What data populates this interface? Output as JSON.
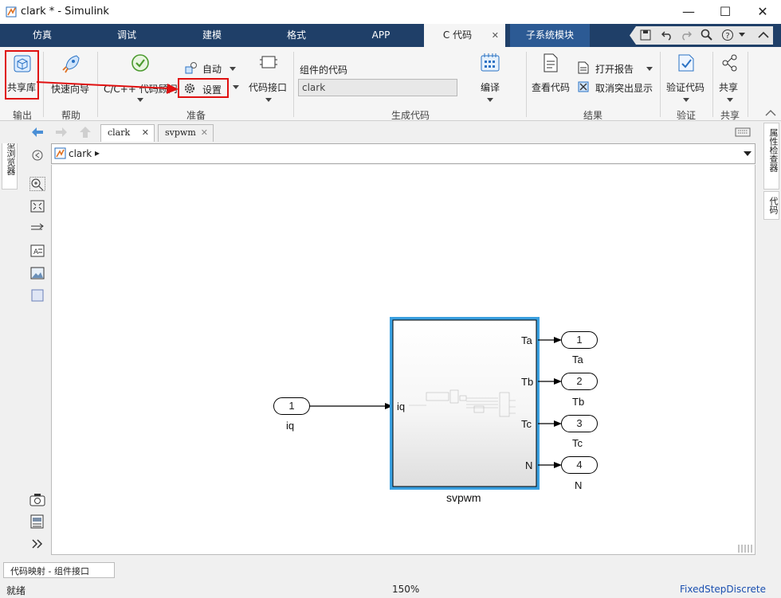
{
  "window": {
    "title": "clark * - Simulink",
    "minimize": "—",
    "maximize": "☐",
    "close": "✕"
  },
  "tabs": [
    "仿真",
    "调试",
    "建模",
    "格式",
    "APP",
    "C 代码",
    "子系统模块"
  ],
  "tab_close": "✕",
  "ribbon": {
    "shared_lib": "共享库",
    "quick_start": "快速向导",
    "advisor": "C/C++ 代码顾问",
    "auto": "自动",
    "settings": "设置",
    "code_interface": "代码接口",
    "component_code_label": "组件的代码",
    "component_code_value": "clark",
    "compile": "编译",
    "view_code": "查看代码",
    "open_report": "打开报告",
    "unhighlight": "取消突出显示",
    "verify_code": "验证代码",
    "share": "共享",
    "groups": {
      "output": "输出",
      "help": "帮助",
      "prepare": "准备",
      "generate": "生成代码",
      "results": "结果",
      "verify": "验证",
      "share": "共享"
    }
  },
  "doc_tabs": [
    "clark",
    "svpwm"
  ],
  "address": {
    "path": "clark",
    "arrow": "▸"
  },
  "left_panel": "模型浏览器",
  "right_panel": {
    "inspector": "属性检查器",
    "code": "代码"
  },
  "model": {
    "inport": {
      "num": "1",
      "name": "iq"
    },
    "subsystem": {
      "name": "svpwm",
      "in": "iq",
      "outs": [
        "Ta",
        "Tb",
        "Tc",
        "N"
      ]
    },
    "outports": [
      {
        "num": "1",
        "name": "Ta"
      },
      {
        "num": "2",
        "name": "Tb"
      },
      {
        "num": "3",
        "name": "Tc"
      },
      {
        "num": "4",
        "name": "N"
      }
    ]
  },
  "bottom": {
    "mapping_tab": "代码映射 - 组件接口",
    "status": "就绪",
    "zoom": "150%",
    "solver": "FixedStepDiscrete"
  },
  "colors": {
    "tabbar": "#1f3f68",
    "highlight": "#e01010",
    "selected": "#3aa0e0",
    "solver_link": "#1a4fb0"
  }
}
